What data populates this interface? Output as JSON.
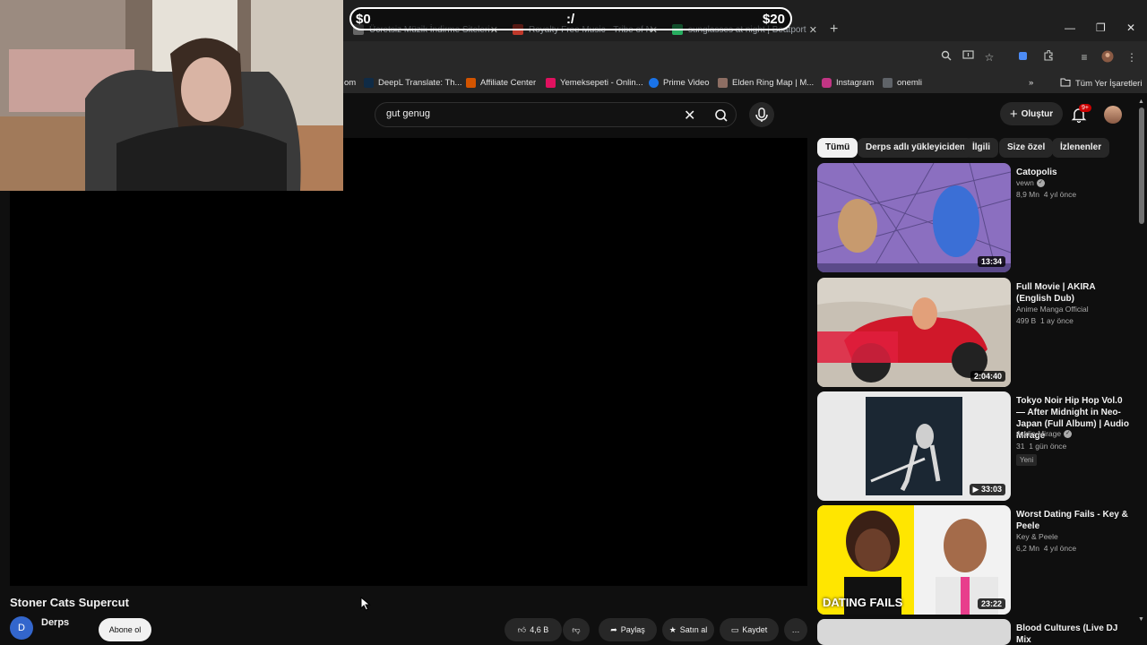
{
  "donation": {
    "left": "$0",
    "center": ":/",
    "right": "$20"
  },
  "tabs": [
    {
      "label": "Ücretsiz Müzik İndirme Siteleri",
      "color": "#666666"
    },
    {
      "label": "Royalty Free Music - Tribe of N",
      "color": "#c0392b"
    },
    {
      "label": "sunglasses at night | Beatport",
      "color": "#27ae60"
    }
  ],
  "newtab_symbol": "+",
  "bookmarks": [
    {
      "label": "om",
      "color": ""
    },
    {
      "label": "DeepL Translate: Th...",
      "color": "#0f2b46"
    },
    {
      "label": "Affiliate Center",
      "color": "#d35400"
    },
    {
      "label": "Yemeksepeti - Onlin...",
      "color": "#e0115f"
    },
    {
      "label": "Prime Video",
      "color": "#1a73e8"
    },
    {
      "label": "Elden Ring Map | M...",
      "color": "#8d6e63"
    },
    {
      "label": "Instagram",
      "color": "#c13584"
    },
    {
      "label": "onemli",
      "color": "#5f6368"
    }
  ],
  "bookmarks_more": "»",
  "all_bookmarks": "Tüm Yer İşaretleri",
  "search": {
    "value": "gut genug"
  },
  "header": {
    "create_label": "Oluştur",
    "notif_count": "9+"
  },
  "video": {
    "title": "Stoner Cats Supercut",
    "channel": "Derps",
    "channel_initial": "D",
    "subscribe_label": "Abone ol"
  },
  "actions": [
    {
      "label": "4,6 B"
    },
    {
      "label": ""
    },
    {
      "label": "Paylaş"
    },
    {
      "label": "Satın al"
    },
    {
      "label": "Kaydet"
    },
    {
      "label": "…"
    }
  ],
  "chips": [
    "Tümü",
    "Derps adlı yükleyiciden",
    "İlgili",
    "Size özel",
    "İzlenenler"
  ],
  "recommendations": [
    {
      "title": "Catopolis",
      "channel": "vewn",
      "verified": true,
      "views": "8,9 Mn",
      "age": "4 yıl önce",
      "duration": "13:34",
      "badge": ""
    },
    {
      "title": "Full Movie | AKIRA (English Dub)",
      "channel": "Anime Manga Official",
      "verified": false,
      "views": "499 B",
      "age": "1 ay önce",
      "duration": "2:04:40",
      "badge": ""
    },
    {
      "title": "Tokyo Noir Hip Hop Vol.0 — After Midnight in Neo-Japan (Full Album) | Audio Mirage",
      "channel": "Audio Mirage",
      "verified": true,
      "views": "31",
      "age": "1 gün önce",
      "duration": "33:03",
      "badge": "Yeni"
    },
    {
      "title": "Worst Dating Fails - Key & Peele",
      "channel": "Key & Peele",
      "verified": false,
      "views": "6,2 Mn",
      "age": "4 yıl önce",
      "duration": "23:22",
      "badge": ""
    },
    {
      "title": "Blood Cultures (Live DJ Mix",
      "channel": "",
      "verified": false,
      "views": "",
      "age": "",
      "duration": "",
      "badge": ""
    }
  ],
  "thumb_caption": "DATING FAILS"
}
